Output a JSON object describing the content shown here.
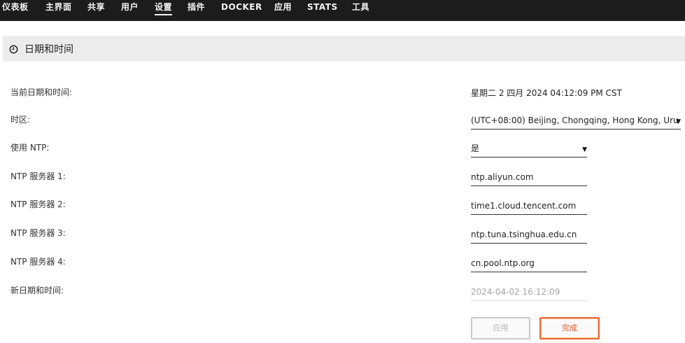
{
  "nav": {
    "items": [
      {
        "label": "仪表板"
      },
      {
        "label": "主界面"
      },
      {
        "label": "共享"
      },
      {
        "label": "用户"
      },
      {
        "label": "设置",
        "active": true
      },
      {
        "label": "插件"
      },
      {
        "label": "DOCKER"
      },
      {
        "label": "应用"
      },
      {
        "label": "STATS"
      },
      {
        "label": "工具"
      }
    ]
  },
  "section": {
    "title": "日期和时间",
    "icon": "clock-icon"
  },
  "form": {
    "current_datetime": {
      "label": "当前日期和时间:",
      "value": "星期二 2 四月 2024 04:12:09 PM CST"
    },
    "timezone": {
      "label": "时区:",
      "value": "(UTC+08:00) Beijing, Chongqing, Hong Kong, Uru"
    },
    "use_ntp": {
      "label": "使用 NTP:",
      "value": "是"
    },
    "ntp1": {
      "label": "NTP 服务器 1:",
      "value": "ntp.aliyun.com"
    },
    "ntp2": {
      "label": "NTP 服务器 2:",
      "value": "time1.cloud.tencent.com"
    },
    "ntp3": {
      "label": "NTP 服务器 3:",
      "value": "ntp.tuna.tsinghua.edu.cn"
    },
    "ntp4": {
      "label": "NTP 服务器 4:",
      "value": "cn.pool.ntp.org"
    },
    "new_datetime": {
      "label": "新日期和时间:",
      "placeholder": "2024-04-02 16:12:09"
    }
  },
  "buttons": {
    "apply": "应用",
    "done": "完成"
  },
  "colors": {
    "nav_bg": "#1c1c1c",
    "accent": "#e8673a",
    "section_bg": "#ececec"
  }
}
